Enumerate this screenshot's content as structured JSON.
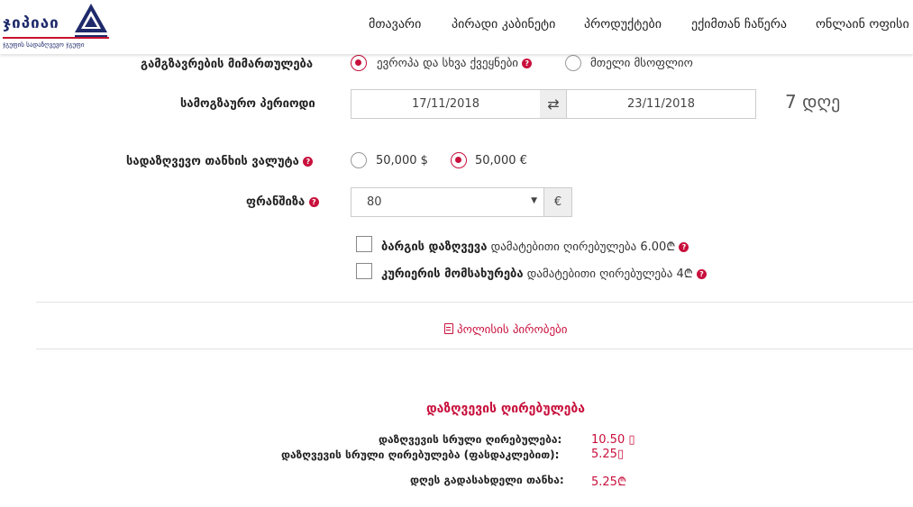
{
  "header": {
    "logo_word": "ჯიპიაი",
    "logo_tagline": "ჯგუფის სადაზღვევო ჯგუფი",
    "nav": [
      "მთავარი",
      "პირადი კაბინეტი",
      "პროდუქტები",
      "ექიმთან ჩაწერა",
      "ონლაინ ოფისი"
    ]
  },
  "direction": {
    "label": "გამგზავრების მიმართულება",
    "options": [
      "ევროპა და სხვა ქვეყნები",
      "მთელი მსოფლიო"
    ],
    "selected": 0
  },
  "period": {
    "label": "სამოგზაურო პერიოდი",
    "start": "17/11/2018",
    "end": "23/11/2018",
    "days": "7 დღე"
  },
  "currency": {
    "label": "სადაზღვევო თანხის ვალუტა",
    "options": [
      "50,000 $",
      "50,000 €"
    ],
    "selected": 1
  },
  "franchise": {
    "label": "ფრანშიზა",
    "value": "80",
    "unit": "€"
  },
  "extras": [
    {
      "name": "ბარგის დაზღვევა",
      "desc": "დამატებითი ღირებულება 6.00₾",
      "checked": false
    },
    {
      "name": "კურიერის მომსახურება",
      "desc": "დამატებითი ღირებულება 4₾",
      "checked": false
    }
  ],
  "policy_link": "პოლისის პირობები",
  "cost": {
    "title": "დაზღვევის ღირებულება",
    "rows": [
      {
        "label": "დაზღვევის სრული ღირებულება:",
        "value": "10.50 ▯"
      },
      {
        "label": "დაზღვევის სრული ღირებულება (ფასდაკლებით):",
        "value": "5.25▯"
      },
      {
        "label": "დღეს გადასახდელი თანხა:",
        "value": "5.25₾"
      }
    ]
  },
  "colors": {
    "accent": "#c8103c",
    "brand": "#1f2a6b"
  }
}
